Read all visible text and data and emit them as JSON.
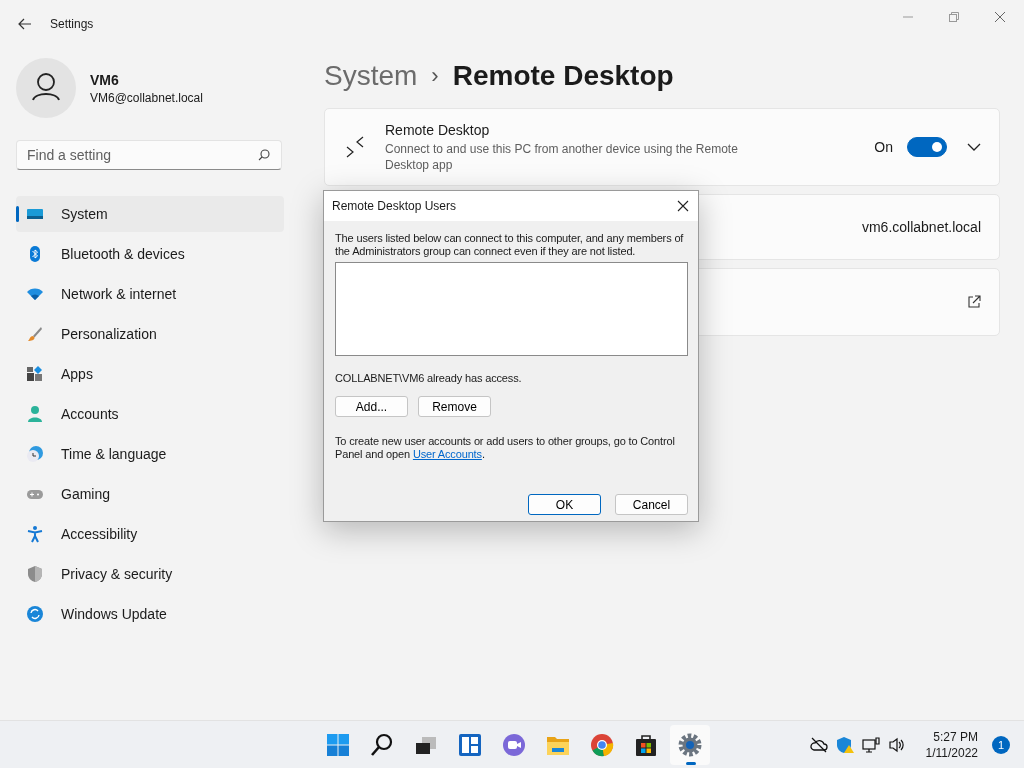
{
  "window": {
    "title": "Settings"
  },
  "account": {
    "name": "VM6",
    "email": "VM6@collabnet.local"
  },
  "search": {
    "placeholder": "Find a setting"
  },
  "nav": [
    {
      "label": "System",
      "kind": "system",
      "selected": true
    },
    {
      "label": "Bluetooth & devices",
      "kind": "bluetooth",
      "selected": false
    },
    {
      "label": "Network & internet",
      "kind": "network",
      "selected": false
    },
    {
      "label": "Personalization",
      "kind": "brush",
      "selected": false
    },
    {
      "label": "Apps",
      "kind": "apps",
      "selected": false
    },
    {
      "label": "Accounts",
      "kind": "accounts",
      "selected": false
    },
    {
      "label": "Time & language",
      "kind": "time",
      "selected": false
    },
    {
      "label": "Gaming",
      "kind": "gaming",
      "selected": false
    },
    {
      "label": "Accessibility",
      "kind": "accessibility",
      "selected": false
    },
    {
      "label": "Privacy & security",
      "kind": "privacy",
      "selected": false
    },
    {
      "label": "Windows Update",
      "kind": "update",
      "selected": false
    }
  ],
  "breadcrumb": {
    "parent": "System",
    "separator": "›",
    "current": "Remote Desktop"
  },
  "cards": [
    {
      "kind": "toggle",
      "title": "Remote Desktop",
      "description": "Connect to and use this PC from another device using the Remote Desktop app",
      "state_label": "On",
      "on": true,
      "expanded": false
    },
    {
      "kind": "value",
      "value": "vm6.collabnet.local"
    },
    {
      "kind": "link"
    }
  ],
  "dialog": {
    "title": "Remote Desktop Users",
    "intro": "The users listed below can connect to this computer, and any members of the Administrators group can connect even if they are not listed.",
    "access_note": "COLLABNET\\VM6 already has access.",
    "add_button": "Add...",
    "remove_button": "Remove",
    "footer_text": "To create new user accounts or add users to other groups, go to Control Panel and open",
    "footer_link": "User Accounts",
    "footer_end": ".",
    "ok_button": "OK",
    "cancel_button": "Cancel"
  },
  "taskbar": {
    "apps": [
      {
        "kind": "start",
        "active": false
      },
      {
        "kind": "search",
        "active": false
      },
      {
        "kind": "taskview",
        "active": false
      },
      {
        "kind": "widgets",
        "active": false
      },
      {
        "kind": "chat",
        "active": false
      },
      {
        "kind": "explorer",
        "active": false
      },
      {
        "kind": "browser",
        "active": false
      },
      {
        "kind": "store",
        "active": false
      },
      {
        "kind": "settings",
        "active": true
      }
    ],
    "time": "5:27 PM",
    "date": "1/11/2022",
    "notifications": "1"
  }
}
